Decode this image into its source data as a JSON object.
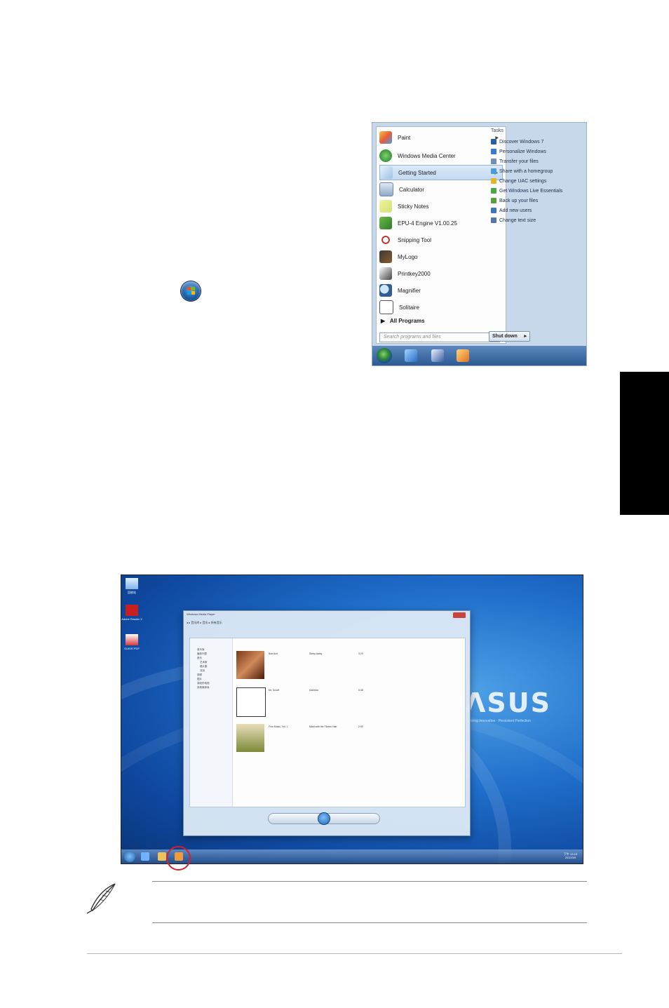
{
  "start_menu": {
    "programs": [
      {
        "label": "Paint",
        "arrow": "▶"
      },
      {
        "label": "Windows Media Center",
        "arrow": ""
      },
      {
        "label": "Getting Started",
        "arrow": "▶"
      },
      {
        "label": "Calculator",
        "arrow": ""
      },
      {
        "label": "Sticky Notes",
        "arrow": ""
      },
      {
        "label": "EPU-4 Engine V1.00.25",
        "arrow": ""
      },
      {
        "label": "Snipping Tool",
        "arrow": ""
      },
      {
        "label": "MyLogo",
        "arrow": ""
      },
      {
        "label": "Printkey2000",
        "arrow": ""
      },
      {
        "label": "Magnifier",
        "arrow": ""
      },
      {
        "label": "Solitaire",
        "arrow": ""
      }
    ],
    "all_programs": "All Programs",
    "all_programs_arrow": "▶",
    "search_placeholder": "Search programs and files",
    "tasks_heading": "Tasks",
    "tasks": [
      "Discover Windows 7",
      "Personalize Windows",
      "Transfer your files",
      "Share with a homegroup",
      "Change UAC settings",
      "Get Windows Live Essentials",
      "Back up your files",
      "Add new users",
      "Change text size"
    ],
    "shutdown_label": "Shut down",
    "shutdown_arrow": "▸"
  },
  "desktop": {
    "brand": "ɅSUS",
    "tagline": "Inspiring Innovation · Persistent Perfection",
    "icons": [
      "回收站",
      "Adobe Reader X",
      "GUIDE.PDF"
    ],
    "player_title": "Windows Media Player",
    "breadcrumb": "◂ ▸  音乐库 ▸ 音乐 ▸ 所有音乐",
    "nav_items": [
      "音乐库",
      "播放列表",
      "音乐",
      "艺术家",
      "唱片集",
      "流派",
      "视频",
      "图片",
      "录制的电视",
      "其他媒体库"
    ],
    "rows": [
      {
        "album": "Bob Acri",
        "title": "Sleep Away",
        "length": "3:20"
      },
      {
        "album": "Mr. Scruff",
        "title": "Kalimba",
        "length": "5:48"
      },
      {
        "album": "Fine Music, Vol. 1",
        "title": "Maid with the Flaxen Hair",
        "length": "2:50"
      }
    ],
    "clock": "下午 12:15\n2010/3/9"
  },
  "colors": {
    "side_tab": "#000000",
    "highlight_circle": "#d4212a"
  }
}
